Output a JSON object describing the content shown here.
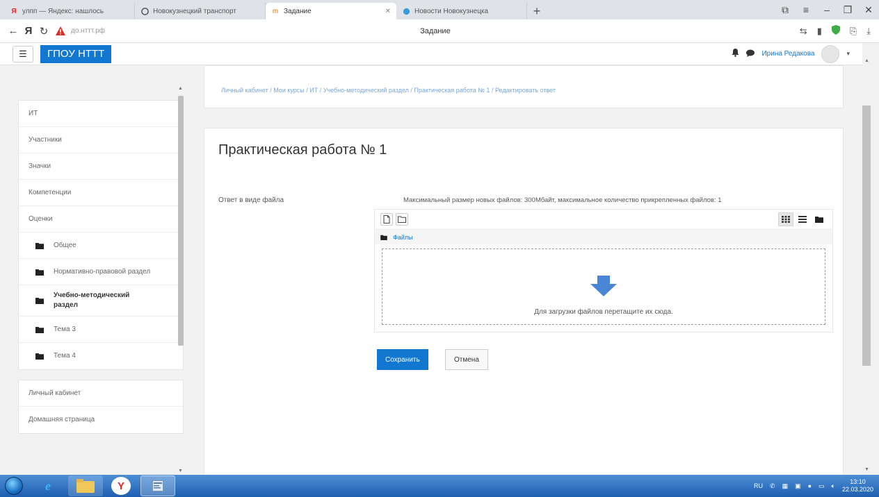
{
  "browser": {
    "tabs": [
      {
        "title": "улпп — Яндекс: нашлось",
        "icon": "yandex-icon",
        "active": false
      },
      {
        "title": "Новокузнецкий транспорт",
        "icon": "opera-icon",
        "active": false
      },
      {
        "title": "Задание",
        "icon": "moodle-icon",
        "active": true
      },
      {
        "title": "Новости Новокузнецка",
        "icon": "news-icon",
        "active": false
      }
    ],
    "new_tab": "+",
    "yandex_logo": "Я",
    "url": "до.нттт.рф",
    "page_title": "Задание"
  },
  "navbar": {
    "menu_icon": "☰",
    "brand": "ГПОУ НТТТ",
    "user_name": "Ирина Редакова"
  },
  "breadcrumb": "Личный кабинет  /  Мои курсы  /  ИТ  /  Учебно-методический раздел  /  Практическая работа № 1  /  Редактировать ответ",
  "sidebar": {
    "items": [
      {
        "label": "ИТ"
      },
      {
        "label": "Участники"
      },
      {
        "label": "Значки"
      },
      {
        "label": "Компетенции"
      },
      {
        "label": "Оценки"
      }
    ],
    "sections": [
      {
        "label": "Общее",
        "bold": false
      },
      {
        "label": "Нормативно-правовой раздел",
        "bold": false
      },
      {
        "label": "Учебно-методический раздел",
        "bold": true
      },
      {
        "label": "Тема 3",
        "bold": false
      },
      {
        "label": "Тема 4",
        "bold": false
      }
    ],
    "bottom": [
      {
        "label": "Личный кабинет"
      },
      {
        "label": "Домашняя страница"
      }
    ]
  },
  "content": {
    "heading": "Практическая работа № 1",
    "field_label": "Ответ в виде файла",
    "max_info": "Максимальный размер новых файлов: 300Мбайт, максимальное количество прикрепленных файлов: 1",
    "path_label": "Файлы",
    "drop_text": "Для загрузки файлов перетащите их сюда.",
    "save_label": "Сохранить",
    "cancel_label": "Отмена"
  },
  "taskbar": {
    "lang": "RU",
    "time": "13:10",
    "date": "22.03.2020"
  },
  "colors": {
    "accent": "#1177d1",
    "drop_arrow": "#4a86d6"
  }
}
